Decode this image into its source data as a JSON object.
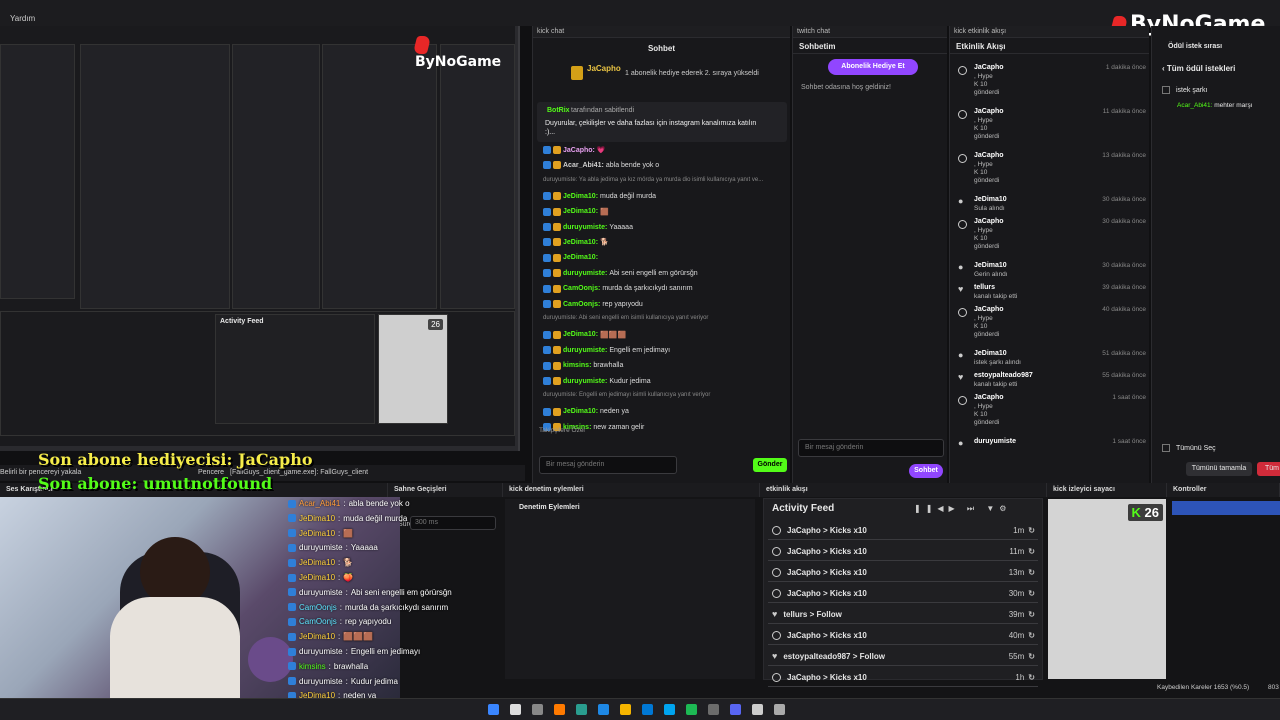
{
  "topbar": {
    "menu": "Yardım"
  },
  "brand": {
    "name": "ByNoGame"
  },
  "left_preview": {
    "activity_title": "Activity Feed",
    "kick_count": "26"
  },
  "kick_chat": {
    "panel": "kick chat",
    "title": "Sohbet",
    "pinned_user": "JaCapho",
    "pinned_sub": "1 abonelik hediye ederek 2. sıraya yükseldi",
    "pin_by": "BotRix",
    "pin_by_suffix": "tarafından sabitlendi",
    "pin_text": "Duyurular, çekilişler ve daha fazlası için instagram kanalımıza katılın :)...",
    "messages": [
      {
        "user": "JaCapho:",
        "text": "💗",
        "c": "#e8a0f0"
      },
      {
        "user": "Acar_Abi41:",
        "text": "abla bende yok o",
        "c": "#cfcfcf"
      },
      {
        "reply": "duruyumiste: Ya abla jedima ya kız mörda ya murda dio isimli kullanıcıya yanıt ve..."
      },
      {
        "user": "JeDima10:",
        "text": "muda değil murda",
        "c": "#53fc18"
      },
      {
        "user": "JeDima10:",
        "text": "🟫",
        "c": "#53fc18"
      },
      {
        "user": "duruyumiste:",
        "text": "Yaaaaa",
        "c": "#53fc18"
      },
      {
        "user": "JeDima10:",
        "text": "🐕",
        "c": "#53fc18"
      },
      {
        "user": "JeDima10:",
        "text": "",
        "c": "#53fc18"
      },
      {
        "user": "duruyumiste:",
        "text": "Abi seni engelli em görürsğn",
        "c": "#53fc18"
      },
      {
        "user": "CamOonjs:",
        "text": "murda da şarkıcıkydı sanırım",
        "c": "#53fc18"
      },
      {
        "user": "CamOonjs:",
        "text": "rep yapıyodu",
        "c": "#53fc18"
      },
      {
        "reply": "duruyumiste: Abi seni engelli em isimli kullanıcıya yanıt veriyor"
      },
      {
        "user": "JeDima10:",
        "text": "🟫🟫🟫",
        "c": "#53fc18"
      },
      {
        "user": "duruyumiste:",
        "text": "Engelli em jedimayı",
        "c": "#53fc18"
      },
      {
        "user": "kimsins:",
        "text": "brawhalla",
        "c": "#53fc18"
      },
      {
        "user": "duruyumiste:",
        "text": "Kudur jedima",
        "c": "#53fc18"
      },
      {
        "reply": "duruyumiste: Engelli em jedimayı isimli kullanıcıya yanıt veriyor"
      },
      {
        "user": "JeDima10:",
        "text": "neden ya",
        "c": "#53fc18"
      },
      {
        "user": "kimsins:",
        "text": "new zaman gelir",
        "c": "#53fc18"
      }
    ],
    "supporters": "Takipçilere Özel",
    "placeholder": "Bir mesaj gönderin",
    "send": "Gönder"
  },
  "twitch_chat": {
    "panel": "twitch chat",
    "title": "Sohbetim",
    "gift_btn": "Abonelik Hediye Et",
    "welcome": "Sohbet odasına hoş geldiniz!",
    "placeholder": "Bir mesaj gönderin",
    "chat_btn": "Sohbet",
    "count": "0"
  },
  "kick_events": {
    "panel": "kick etkinlik akışı",
    "title": "Etkinlik Akışı",
    "items": [
      {
        "name": "JaCapho",
        "l1": ", Hype",
        "l2": "10",
        "l3": "gönderdi",
        "time": "1 dakika önce",
        "t": "kick"
      },
      {
        "name": "JaCapho",
        "l1": ", Hype",
        "l2": "10",
        "l3": "gönderdi",
        "time": "11 dakika önce",
        "t": "kick"
      },
      {
        "name": "JaCapho",
        "l1": ", Hype",
        "l2": "10",
        "l3": "gönderdi",
        "time": "13 dakika önce",
        "t": "kick"
      },
      {
        "name": "JeDima10",
        "l1": "Sula alındı",
        "time": "30 dakika önce",
        "t": "user"
      },
      {
        "name": "JaCapho",
        "l1": ", Hype",
        "l2": "10",
        "l3": "gönderdi",
        "time": "30 dakika önce",
        "t": "kick"
      },
      {
        "name": "JeDima10",
        "l1": "Gerin alındı",
        "time": "30 dakika önce",
        "t": "user"
      },
      {
        "name": "tellurs",
        "l1": "kanalı takip etti",
        "time": "39 dakika önce",
        "t": "heart"
      },
      {
        "name": "JaCapho",
        "l1": ", Hype",
        "l2": "10",
        "l3": "gönderdi",
        "time": "40 dakika önce",
        "t": "kick"
      },
      {
        "name": "JeDima10",
        "l1": "istek şarkı alındı",
        "time": "51 dakika önce",
        "t": "user"
      },
      {
        "name": "estoypalteado987",
        "l1": "kanalı takip etti",
        "time": "55 dakika önce",
        "t": "heart"
      },
      {
        "name": "JaCapho",
        "l1": ", Hype",
        "l2": "10",
        "l3": "gönderdi",
        "time": "1 saat önce",
        "t": "kick"
      },
      {
        "name": "duruyumiste",
        "l1": "",
        "time": "1 saat önce",
        "t": "user"
      }
    ]
  },
  "song_requests": {
    "panel": "Ödül istek sırası",
    "back": "Tüm ödül istekleri",
    "item": "istek şarkı",
    "req_user": "Acar_Abi41:",
    "req_text": "mehter marşı",
    "select_all": "Tümünü Seç",
    "complete_all": "Tümünü tamamla",
    "delete": "Tüm"
  },
  "overlay": {
    "gift_line": "Son abone hediyecisi: JaCapho",
    "sub_line": "Son abone: umutnotfound",
    "chat": [
      {
        "u": "Acar_Abi41",
        "t": "abla bende yok o",
        "c": "#ff9c3a"
      },
      {
        "u": "JeDima10",
        "t": "muda değil murda",
        "c": "#ffd23a"
      },
      {
        "u": "JeDima10",
        "t": "🟫",
        "c": "#ffd23a"
      },
      {
        "u": "duruyumiste",
        "t": "Yaaaaa",
        "c": "#fff"
      },
      {
        "u": "JeDima10",
        "t": "🐕",
        "c": "#ffd23a"
      },
      {
        "u": "JeDima10",
        "t": "🍑",
        "c": "#ffd23a"
      },
      {
        "u": "duruyumiste",
        "t": "Abi seni engelli em görürsğn",
        "c": "#fff"
      },
      {
        "u": "CamOonjs",
        "t": "murda da şarkıcıkydı sanırım",
        "c": "#5ee6ff"
      },
      {
        "u": "CamOonjs",
        "t": "rep yapıyodu",
        "c": "#5ee6ff"
      },
      {
        "u": "JeDima10",
        "t": "🟫🟫🟫",
        "c": "#ffd23a"
      },
      {
        "u": "duruyumiste",
        "t": "Engelli em jedimayı",
        "c": "#fff"
      },
      {
        "u": "kimsins",
        "t": "brawhalla",
        "c": "#53fc18"
      },
      {
        "u": "duruyumiste",
        "t": "Kudur jedima",
        "c": "#fff"
      },
      {
        "u": "JeDima10",
        "t": "neden ya",
        "c": "#ffd23a"
      },
      {
        "u": "kimsins",
        "t": "new zaman gelir",
        "c": "#53fc18"
      }
    ]
  },
  "dock": {
    "window_capture": "Belirli bir pencereyi yakala",
    "window": "Pencere",
    "window_value": "[FallGuys_client_game.exe]: FallGuys_client",
    "audio": "Ses Karıştırıcı",
    "transitions": "Sahne Geçişleri",
    "duration_label": "Süre",
    "duration": "300 ms",
    "kick_mod": "kick denetim eylemleri",
    "mod_title": "Denetim Eylemleri",
    "activity_panel": "etkinlik akışı",
    "activity_title": "Activity Feed",
    "viewer_panel": "kick izleyici sayacı",
    "viewers": "26",
    "controls": "Kontroller",
    "stats": "Kaybedilen Kareler 1653 (%0.5)",
    "stats2": "803"
  },
  "activity_feed": [
    {
      "text": "JaCapho > Kicks x10",
      "time": "1m",
      "t": "kick"
    },
    {
      "text": "JaCapho > Kicks x10",
      "time": "11m",
      "t": "kick"
    },
    {
      "text": "JaCapho > Kicks x10",
      "time": "13m",
      "t": "kick"
    },
    {
      "text": "JaCapho > Kicks x10",
      "time": "30m",
      "t": "kick"
    },
    {
      "text": "tellurs > Follow",
      "time": "39m",
      "t": "heart"
    },
    {
      "text": "JaCapho > Kicks x10",
      "time": "40m",
      "t": "kick"
    },
    {
      "text": "estoypalteado987 > Follow",
      "time": "55m",
      "t": "heart"
    },
    {
      "text": "JaCapho > Kicks x10",
      "time": "1h",
      "t": "kick"
    }
  ]
}
